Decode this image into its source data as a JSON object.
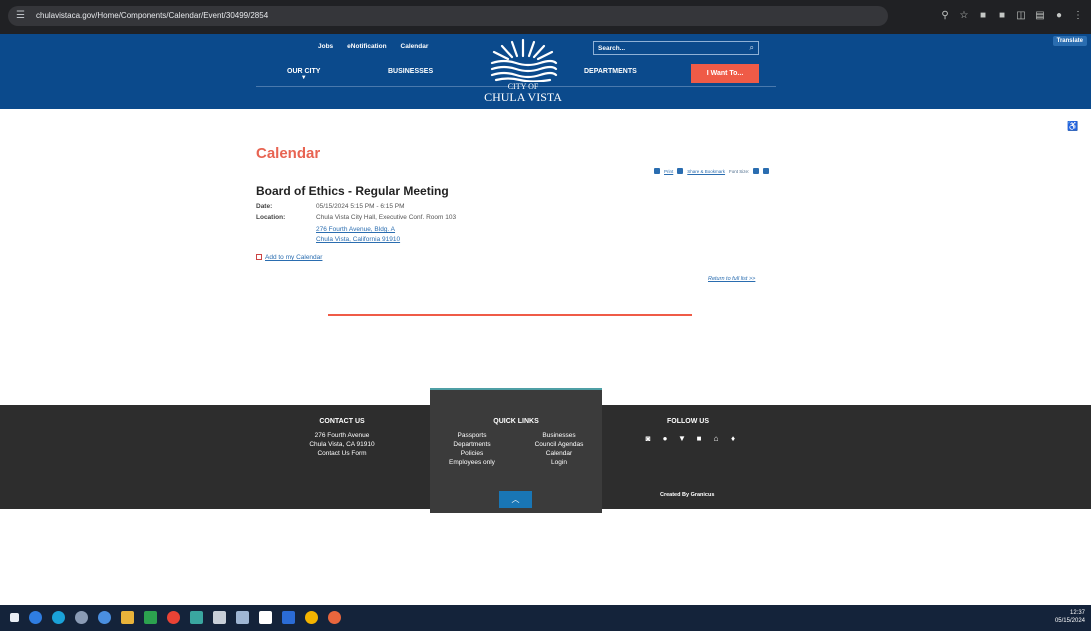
{
  "browser": {
    "url": "chulavistaca.gov/Home/Components/Calendar/Event/30499/2854"
  },
  "header": {
    "translate": "Translate",
    "top_links": [
      "Jobs",
      "eNotification",
      "Calendar"
    ],
    "search_placeholder": "Search...",
    "nav": {
      "our_city": "OUR CITY",
      "businesses": "BUSINESSES",
      "departments": "DEPARTMENTS",
      "i_want_to": "I Want To..."
    },
    "logo": {
      "city_of": "CITY OF",
      "name": "CHULA VISTA"
    }
  },
  "main": {
    "page_title": "Calendar",
    "tools": {
      "print": "Print",
      "share": "Share & Bookmark",
      "font_size": "Font Size:"
    },
    "event": {
      "title": "Board of Ethics - Regular Meeting",
      "date_label": "Date:",
      "date_value": "05/15/2024 5:15 PM - 6:15 PM",
      "location_label": "Location:",
      "location_value": "Chula Vista City Hall, Executive Conf. Room 103",
      "address_line1": "276 Fourth Avenue, Bldg. A",
      "address_line2": "Chula Vista, California 91910"
    },
    "add_to_calendar": "Add to my Calendar",
    "return_link": "Return to full list >>"
  },
  "footer": {
    "contact": {
      "heading": "CONTACT US",
      "line1": "276 Fourth Avenue",
      "line2": "Chula Vista, CA 91910",
      "line3": "Contact Us Form"
    },
    "quick_links": {
      "heading": "QUICK LINKS",
      "left": [
        "Passports",
        "Departments",
        "Policies",
        "Employees only"
      ],
      "right": [
        "Businesses",
        "Council Agendas",
        "Calendar",
        "Login"
      ]
    },
    "follow": {
      "heading": "FOLLOW US",
      "icons": [
        "instagram-icon",
        "facebook-icon",
        "twitter-icon",
        "youtube-icon",
        "nextdoor-icon",
        "map-pin-icon"
      ]
    },
    "created_by": "Created By Granicus"
  },
  "taskbar": {
    "time": "12:37",
    "date": "05/15/2024"
  }
}
